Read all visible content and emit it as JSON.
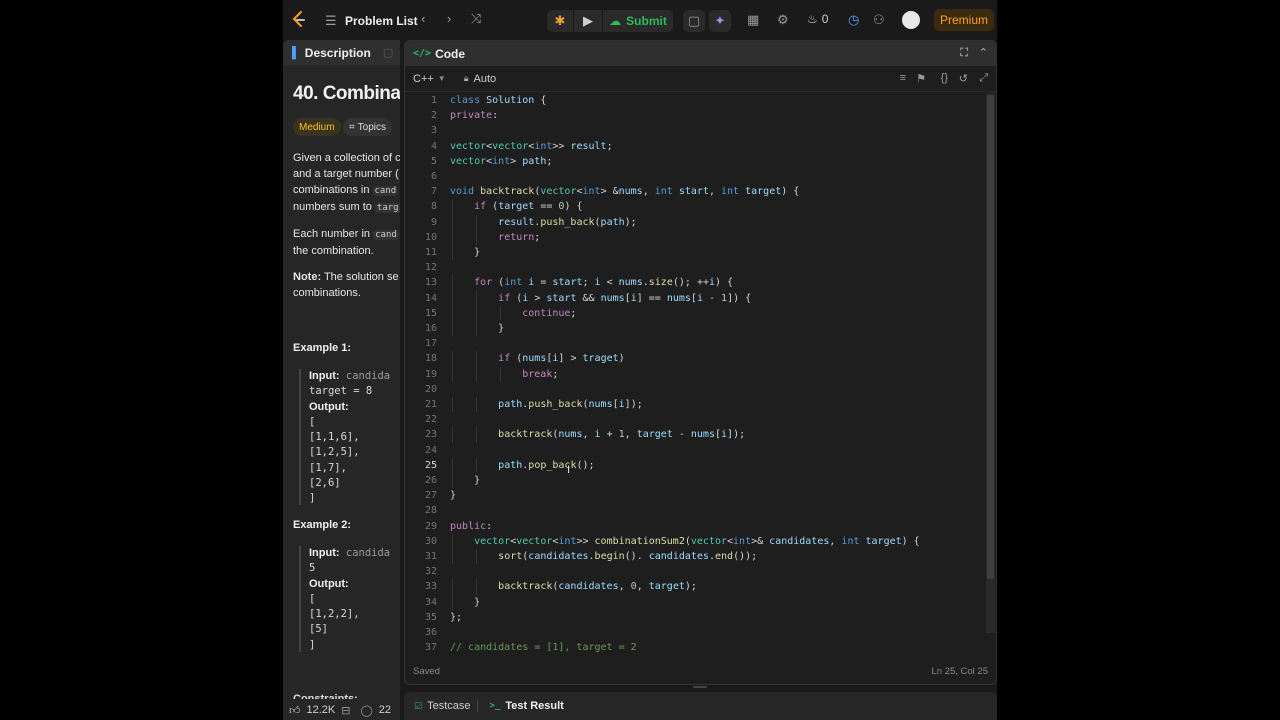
{
  "nav": {
    "problem_list": "Problem List",
    "submit": "Submit",
    "streak_count": "0",
    "premium": "Premium",
    "icons": [
      "logo-icon",
      "list-icon",
      "chevron-left-icon",
      "chevron-right-icon",
      "shuffle-icon",
      "debug-icon",
      "play-icon",
      "cloud-upload-icon",
      "note-icon",
      "ai-sparkle-icon",
      "layout-icon",
      "gear-icon",
      "fire-icon",
      "timer-icon",
      "add-friend-icon"
    ]
  },
  "description": {
    "tab_label": "Description",
    "title": "40. Combina",
    "difficulty": "Medium",
    "difficulty_color": "#ffc01e",
    "topics": "Topics",
    "para1": [
      {
        "text": "Given a collection of c"
      },
      {
        "text": "and a target number ("
      },
      {
        "text": "combinations in ",
        "code": "cand"
      },
      {
        "text": "numbers sum to ",
        "code": "targ"
      }
    ],
    "para2": [
      {
        "text": "Each number in ",
        "code": "cand"
      },
      {
        "text": "the combination."
      }
    ],
    "note_label": "Note:",
    "note_rest": " The solution se",
    "note_line2": "combinations.",
    "example1_title": "Example 1:",
    "example1": {
      "input_label": "Input:",
      "input_value": " candida",
      "input_line2": "target = 8",
      "output_label": "Output:",
      "output_lines": [
        "[",
        "[1,1,6],",
        "[1,2,5],",
        "[1,7],",
        "[2,6]",
        "]"
      ]
    },
    "example2_title": "Example 2:",
    "example2": {
      "input_label": "Input:",
      "input_value": " candida",
      "input_line2": "5",
      "output_label": "Output:",
      "output_lines": [
        "[",
        "[1,2,2],",
        "[5]",
        "]"
      ]
    },
    "constraints_partial": "Constraints:",
    "likes": "12.2K",
    "comments": "22"
  },
  "code": {
    "panel_title": "Code",
    "language": "C++",
    "mode": "Auto",
    "saved": "Saved",
    "cursor_pos": "Ln 25, Col 25",
    "active_line": 25,
    "lines": [
      "class Solution {",
      "private:",
      "",
      "vector<vector<int>> result;",
      "vector<int> path;",
      "",
      "void backtrack(vector<int> &nums, int start, int target) {",
      "    if (target == 0) {",
      "        result.push_back(path);",
      "        return;",
      "    }",
      "",
      "    for (int i = start; i < nums.size(); ++i) {",
      "        if (i > start && nums[i] == nums[i - 1]) {",
      "            continue;",
      "        }",
      "",
      "        if (nums[i] > traget)",
      "            break;",
      "",
      "        path.push_back(nums[i]);",
      "",
      "        backtrack(nums, i + 1, target - nums[i]);",
      "",
      "        path.pop_back();",
      "    }",
      "}",
      "",
      "public:",
      "    vector<vector<int>> combinationSum2(vector<int>& candidates, int target) {",
      "        sort(candidates.begin(). candidates.end());",
      "",
      "        backtrack(candidates, 0, target);",
      "    }",
      "};",
      "",
      "// candidates = [1], target = 2"
    ]
  },
  "bottom": {
    "testcase": "Testcase",
    "test_result": "Test Result"
  }
}
